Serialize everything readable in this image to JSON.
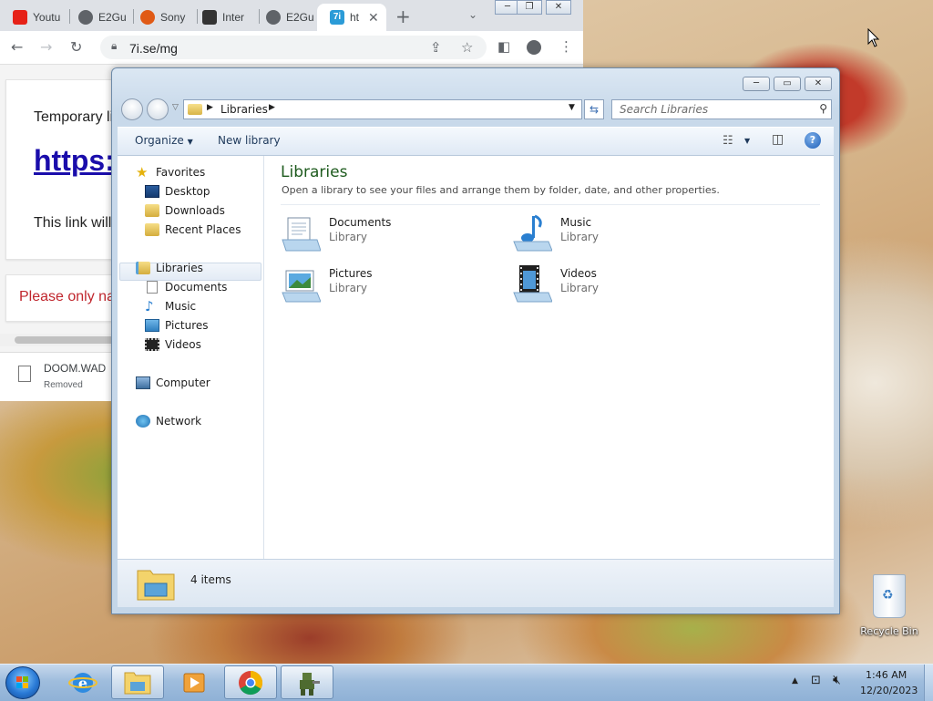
{
  "browser": {
    "tabs": [
      {
        "label": "Youtu",
        "color": "#e62117"
      },
      {
        "label": "E2Gu",
        "color": "#5f6368"
      },
      {
        "label": "Sony",
        "color": "#e05a16"
      },
      {
        "label": "Inter",
        "color": "#333333"
      },
      {
        "label": "E2Gu",
        "color": "#5f6368"
      },
      {
        "label": "ht",
        "color": "#2b9bd7",
        "favicon_text": "7i",
        "active": true
      }
    ],
    "new_tab": "+",
    "url": "7i.se/mg",
    "page": {
      "line1": "Temporary li",
      "link": "https:",
      "line2": "This link will",
      "warning": "Please only na"
    },
    "download": {
      "filename": "DOOM.WAD",
      "status": "Removed"
    }
  },
  "explorer": {
    "breadcrumb": "Libraries",
    "search_placeholder": "Search Libraries",
    "toolbar": {
      "organize": "Organize",
      "new_library": "New library"
    },
    "nav": {
      "favorites": "Favorites",
      "fav_items": [
        "Desktop",
        "Downloads",
        "Recent Places"
      ],
      "libraries": "Libraries",
      "lib_items": [
        "Documents",
        "Music",
        "Pictures",
        "Videos"
      ],
      "computer": "Computer",
      "network": "Network"
    },
    "heading": "Libraries",
    "subheading": "Open a library to see your files and arrange them by folder, date, and other properties.",
    "libraries": [
      {
        "name": "Documents",
        "type": "Library",
        "icon": "documents-library-icon"
      },
      {
        "name": "Music",
        "type": "Library",
        "icon": "music-library-icon"
      },
      {
        "name": "Pictures",
        "type": "Library",
        "icon": "pictures-library-icon"
      },
      {
        "name": "Videos",
        "type": "Library",
        "icon": "videos-library-icon"
      }
    ],
    "details": {
      "count": "4 items"
    }
  },
  "desktop": {
    "recycle_bin": "Recycle Bin"
  },
  "taskbar": {
    "time": "1:46 AM",
    "date": "12/20/2023"
  }
}
